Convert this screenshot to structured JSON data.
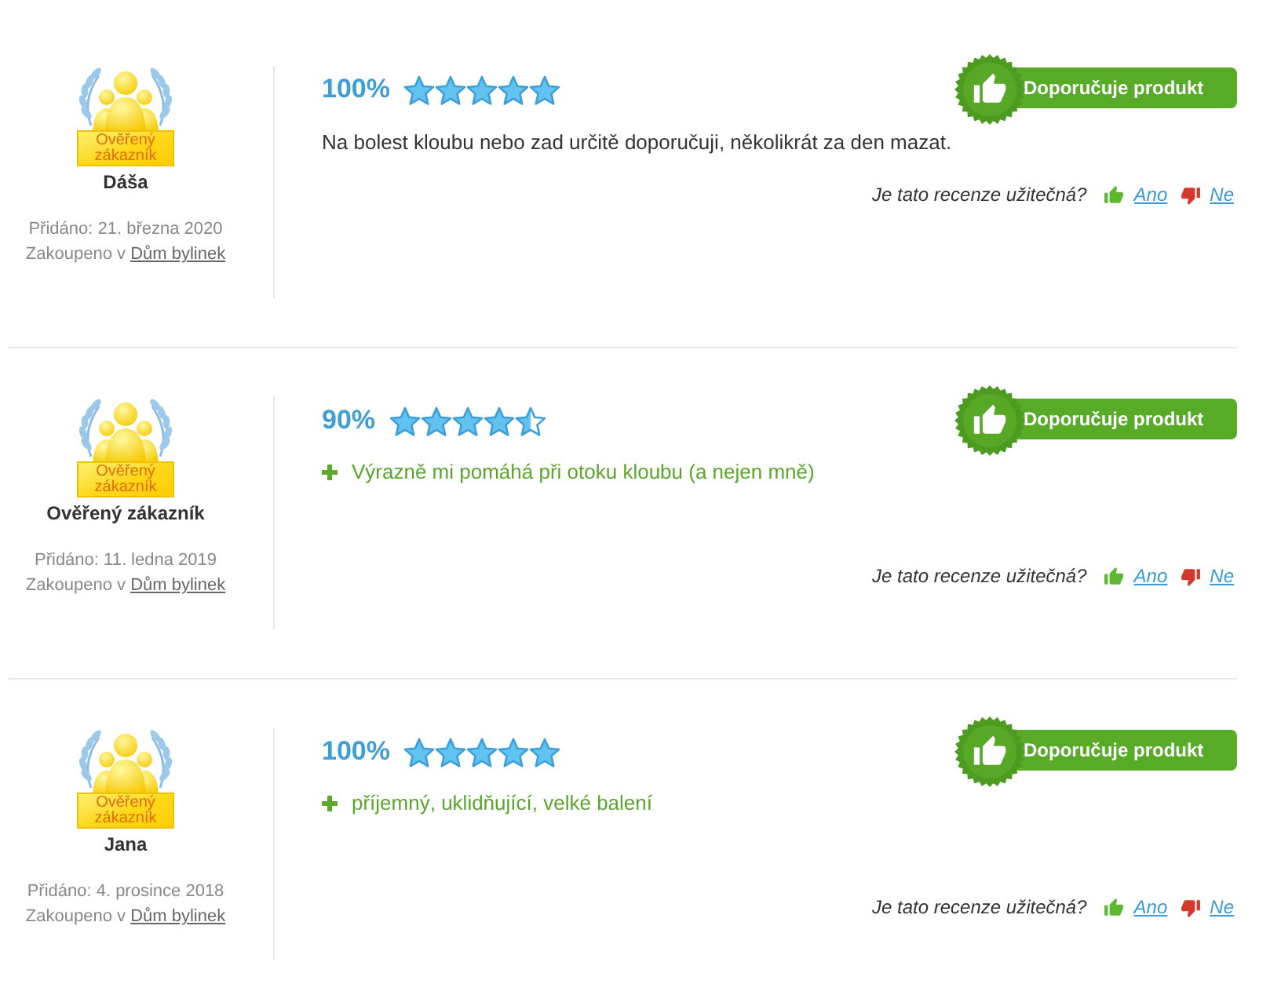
{
  "reviews": [
    {
      "author": {
        "verified_label": "Ověřený zákazník",
        "name": "Dáša"
      },
      "added": "Přidáno: 21. března 2020",
      "purchased": {
        "prefix": "Zakoupeno v",
        "shop": "Dům bylinek"
      },
      "rating": "100%",
      "stars": 5,
      "recommends": true,
      "recommend_label": "Doporučuje produkt",
      "body": {
        "kind": "text",
        "text": "Na bolest kloubu nebo zad určitě doporučuji, několikrát za den mazat."
      },
      "helpful": {
        "question": "Je tato recenze užitečná?",
        "yes": "Ano",
        "no": "Ne"
      }
    },
    {
      "author": {
        "verified_label": "Ověřený zákazník",
        "name": "Ověřený zákazník"
      },
      "added": "Přidáno: 11. ledna 2019",
      "purchased": {
        "prefix": "Zakoupeno v",
        "shop": "Dům bylinek"
      },
      "rating": "90%",
      "stars": 4.5,
      "recommends": true,
      "recommend_label": "Doporučuje produkt",
      "body": {
        "kind": "pros",
        "items": [
          "Výrazně mi pomáhá při otoku kloubu (a nejen mně)"
        ]
      },
      "helpful": {
        "question": "Je tato recenze užitečná?",
        "yes": "Ano",
        "no": "Ne"
      }
    },
    {
      "author": {
        "verified_label": "Ověřený zákazník",
        "name": "Jana"
      },
      "added": "Přidáno: 4. prosince 2018",
      "purchased": {
        "prefix": "Zakoupeno v",
        "shop": "Dům bylinek"
      },
      "rating": "100%",
      "stars": 5,
      "recommends": true,
      "recommend_label": "Doporučuje produkt",
      "body": {
        "kind": "pros",
        "items": [
          "příjemný, uklidňující, velké balení"
        ]
      },
      "helpful": {
        "question": "Je tato recenze užitečná?",
        "yes": "Ano",
        "no": "Ne"
      }
    }
  ]
}
